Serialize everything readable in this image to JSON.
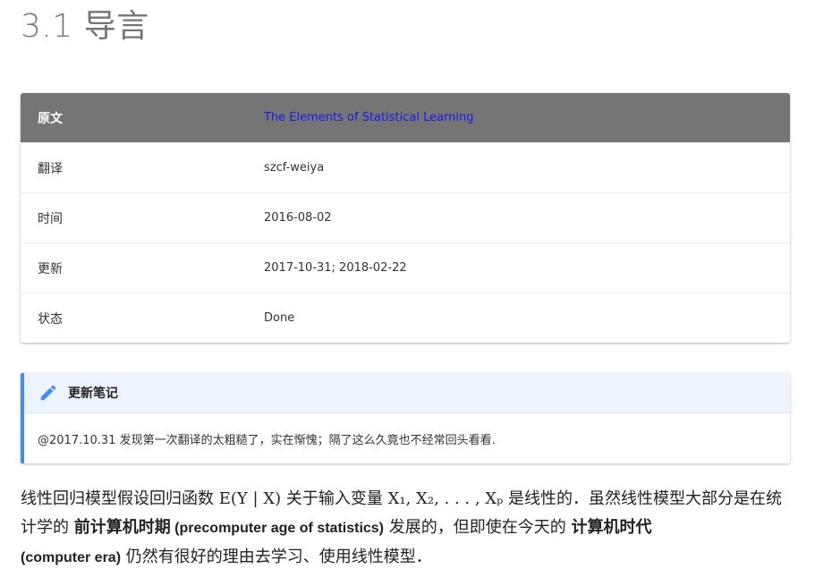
{
  "page": {
    "title": "3.1 导言"
  },
  "info_table": {
    "header": {
      "key": "原文",
      "value": "The Elements of Statistical Learning"
    },
    "rows": [
      {
        "key": "翻译",
        "value": "szcf-weiya"
      },
      {
        "key": "时间",
        "value": "2016-08-02"
      },
      {
        "key": "更新",
        "value": "2017-10-31; 2018-02-22"
      },
      {
        "key": "状态",
        "value": "Done"
      }
    ]
  },
  "admonition": {
    "icon": "pencil-icon",
    "title": "更新笔记",
    "body": "@2017.10.31 发现第一次翻译的太粗糙了，实在惭愧；隔了这么久竟也不经常回头看看."
  },
  "paragraph": {
    "p1": "线性回归模型假设回归函数 ",
    "math1": "E(Y | X)",
    "p2": " 关于输入变量 ",
    "math2": "X₁, X₂, . . . , Xₚ",
    "p3": " 是线性的．虽然线性模型大部分是在统计学的 ",
    "strong1": "前计算机时期",
    "strong1_en": " (precomputer age of statistics)",
    "p4": " 发展的，但即使在今天的 ",
    "strong2": "计算机时代",
    "strong2_en": "(computer era)",
    "p5": " 仍然有很好的理由去学习、使用线性模型．"
  },
  "colors": {
    "table_header": "#757575",
    "link": "#1a1aee",
    "admonition_accent": "#448aff",
    "admonition_title_bg": "#ecf3ff"
  }
}
